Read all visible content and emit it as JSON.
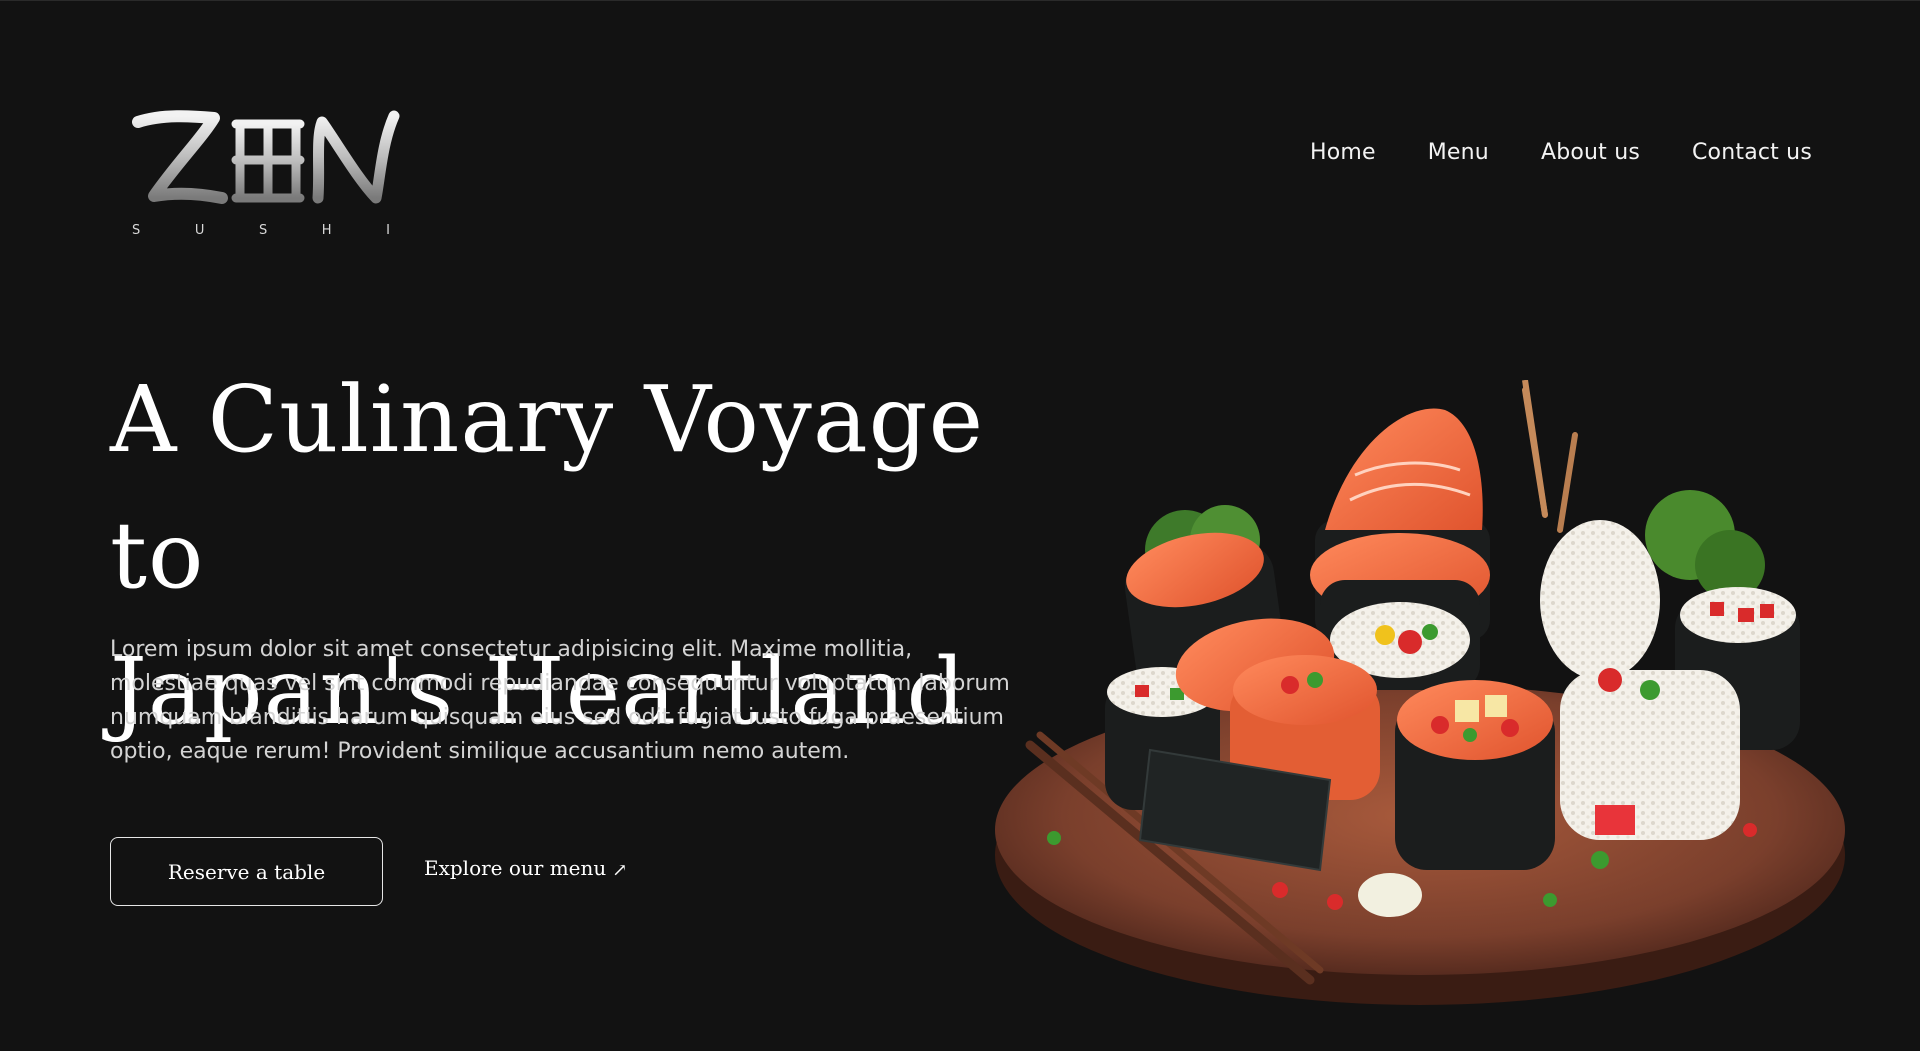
{
  "brand": {
    "logo_mark": "ZEN",
    "logo_subtext": "S U S H I",
    "logo_letters": [
      "S",
      "U",
      "S",
      "H",
      "I"
    ]
  },
  "nav": {
    "items": [
      "Home",
      "Menu",
      "About us",
      "Contact us"
    ]
  },
  "hero": {
    "title_line1": "A Culinary Voyage to",
    "title_line2": "Japan's Heartland",
    "description_line1": "Lorem ipsum dolor sit amet consectetur adipisicing elit. Maxime mollitia,",
    "description_line2": "molestiae quas vel sint commodi repudiandae consequuntur voluptatum laborum",
    "description_line3": "numquam blanditiis harum quisquam eius sed odit fugiat iusto fuga praesentium",
    "description_line4": "optio, eaque rerum! Provident similique accusantium nemo autem.",
    "primary_cta": "Reserve a table",
    "secondary_cta": "Explore our menu",
    "secondary_cta_icon": "arrow-up-right-icon"
  },
  "colors": {
    "background": "#121212",
    "text": "#ffffff",
    "muted_text": "#d4d4d4",
    "salmon": "#f07a4f",
    "nori": "#1b1d1d",
    "board": "#7a3f2c"
  },
  "image": {
    "name": "sushi-platter-image"
  }
}
